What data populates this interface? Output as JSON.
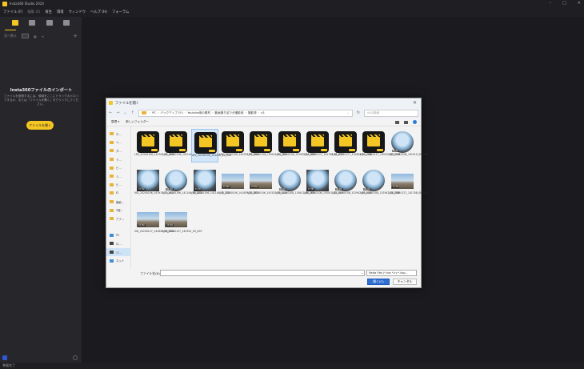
{
  "app": {
    "title": "Insta360 Studio 2024"
  },
  "menu": {
    "items": [
      "ファイル (F)",
      "編集 (E)",
      "再生",
      "環境",
      "ウィンドウ",
      "ヘルプ (H)",
      "フォーラム"
    ]
  },
  "sidebar": {
    "tool_label": "並べ替え",
    "import_title": "Insta360ファイルのインポート",
    "import_desc": "ファイルを参照するには、領域をここにドラッグ＆ドロップするか、または「ファイルを開く」をクリックしてください。",
    "open_button": "ファイルを開く"
  },
  "status": {
    "text": "準備完了"
  },
  "dialog": {
    "title": "ファイルを開く",
    "breadcrumb": [
      "PC",
      "バックアップ (F:)",
      "Youtube用の素材",
      "動画撮り足り分撮影用",
      "撮影済",
      "x3"
    ],
    "search_placeholder": "x3の検索",
    "organize": "整理 ▾",
    "new_folder": "新しいフォルダー",
    "nav_items": [
      {
        "label": "ホ…",
        "icon": "folder"
      },
      {
        "label": "リ…",
        "icon": "folder"
      },
      {
        "label": "ダ…",
        "icon": "folder"
      },
      {
        "label": "ド…",
        "icon": "folder"
      },
      {
        "label": "ピ…",
        "icon": "folder"
      },
      {
        "label": "ミ…",
        "icon": "folder"
      },
      {
        "label": "ビ…",
        "icon": "folder"
      },
      {
        "label": "f2",
        "icon": "folder"
      },
      {
        "label": "撮影…",
        "icon": "folder"
      },
      {
        "label": "Y撮…",
        "icon": "folder"
      },
      {
        "label": "アフ…",
        "icon": "folder"
      }
    ],
    "nav_tree": [
      {
        "label": "PC",
        "icon": "pc"
      },
      {
        "label": "ロ…",
        "icon": "drive"
      },
      {
        "label": "バ…",
        "icon": "drive"
      },
      {
        "label": "ネット",
        "icon": "network"
      }
    ],
    "files": [
      {
        "name": "LRV_20240106_141915_11_003",
        "kind": "lrv"
      },
      {
        "name": "LRV_20240106_141144_10_002",
        "kind": "lrv"
      },
      {
        "name": "LRV_20240106_141405_01_002",
        "kind": "lrv",
        "selected": true
      },
      {
        "name": "LRV_20240106_141520_01_004",
        "kind": "lrv"
      },
      {
        "name": "LRV_20240108_150411_11_005",
        "kind": "lrv"
      },
      {
        "name": "LRV_20240108_151942_11_006",
        "kind": "lrv"
      },
      {
        "name": "LRV_20240127_141748_01_007",
        "kind": "lrv"
      },
      {
        "name": "LRV_20240127_142846_01_008",
        "kind": "lrv"
      },
      {
        "name": "LRV_20240127_145322_01_009",
        "kind": "lrv"
      },
      {
        "name": "VID_20240106_141915_00_001",
        "kind": "vid-fish"
      },
      {
        "name": "VID_20240106_141915_10_001",
        "kind": "vid-sq"
      },
      {
        "name": "VID_20240106_141144_00_002",
        "kind": "vid-fish"
      },
      {
        "name": "VID_20240106_141144_10_002",
        "kind": "vid-sq"
      },
      {
        "name": "VID_20240106_141405_00_003",
        "kind": "vid-pano"
      },
      {
        "name": "VID_20240106_141520_00_004",
        "kind": "vid-pano"
      },
      {
        "name": "VID_20240108_150411_00_005",
        "kind": "vid-fish"
      },
      {
        "name": "VID_20240108_150411_10_005",
        "kind": "vid-sq"
      },
      {
        "name": "VID_20240108_151942_00_006",
        "kind": "vid-fish"
      },
      {
        "name": "VID_20240108_151942_10_006",
        "kind": "vid-fish"
      },
      {
        "name": "VID_20240127_141748_00_007",
        "kind": "vid-pano"
      },
      {
        "name": "VID_20240127_142846_00_008",
        "kind": "vid-pano"
      },
      {
        "name": "VID_20240127_145322_00_009",
        "kind": "vid-pano"
      }
    ],
    "filename_label": "ファイル名(N):",
    "filename_value": "",
    "filetype": "Media Files (*.insv *.lrv *.insp...",
    "open_button": "開く(O)",
    "cancel_button": "キャンセル",
    "badge_text": "X3 360"
  },
  "colors": {
    "accent": "#f3c623",
    "primary_button": "#2f6fd1"
  }
}
